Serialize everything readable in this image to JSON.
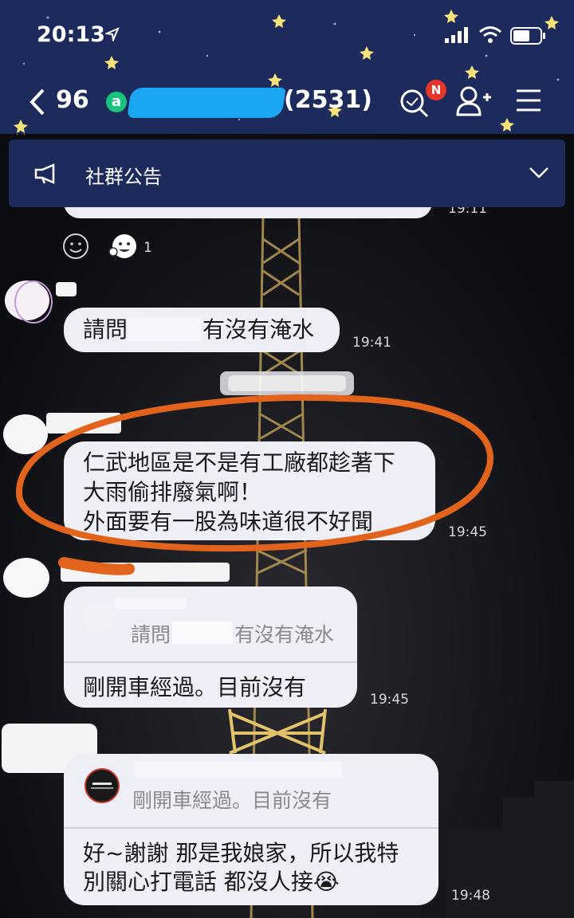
{
  "status_bar": {
    "time": "20:13"
  },
  "nav": {
    "back_count": "96",
    "group_icon": "a",
    "member_count": "(2531)",
    "notification_badge": "N"
  },
  "announcement": {
    "label": "社群公告"
  },
  "reactions": {
    "count": "1"
  },
  "messages": [
    {
      "text": "請問",
      "text_suffix": "有沒有淹水",
      "time": "19:41"
    },
    {
      "lines": [
        "仁武地區是不是有工廠都趁著下",
        "大雨偷排廢氣啊！",
        "外面要有一股為味道很不好聞"
      ],
      "time": "19:45"
    },
    {
      "quote_prefix": "請問",
      "quote_suffix": "有沒有淹水",
      "text": "剛開車經過。目前沒有",
      "time": "19:45"
    },
    {
      "quote": "剛開車經過。目前沒有",
      "lines": [
        "好~謝謝 那是我娘家，所以我特",
        "別關心打電話 都沒人接😭"
      ],
      "time": "19:48"
    }
  ],
  "top_time_partial": "19:11",
  "colors": {
    "header": "#1c2a5c",
    "bubble": "#eeeef6",
    "highlight_ring": "#e2641c",
    "name_redaction": "#1ba6f2",
    "badge": "#e6352b"
  }
}
